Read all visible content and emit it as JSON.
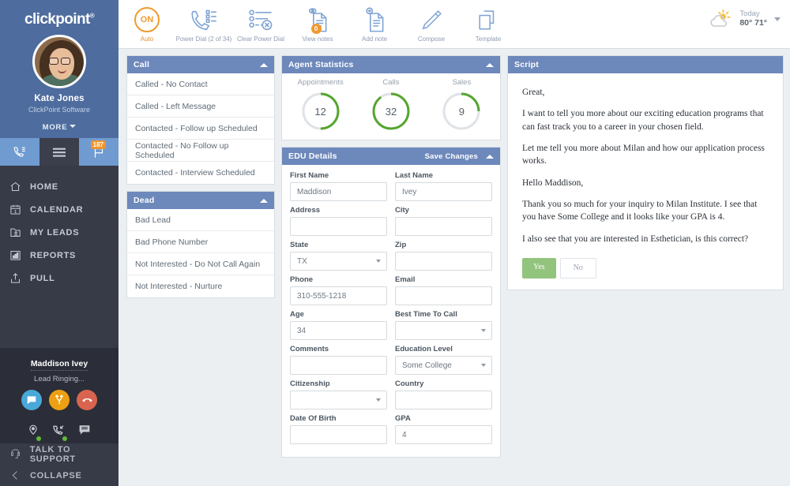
{
  "brand": {
    "logo": "clickpoint",
    "trademark": "®",
    "accent_blue": "#4e6c9e",
    "accent_orange": "#ef9a2e",
    "header_blue": "#6d88bb",
    "green": "#55a630"
  },
  "sidebar": {
    "user_name": "Kate Jones",
    "company": "ClickPoint Software",
    "more_label": "MORE",
    "flag_badge": "187",
    "nav": [
      {
        "label": "HOME",
        "icon": "home-icon"
      },
      {
        "label": "CALENDAR",
        "icon": "calendar-icon"
      },
      {
        "label": "MY LEADS",
        "icon": "leads-folder-icon"
      },
      {
        "label": "REPORTS",
        "icon": "bar-chart-icon"
      },
      {
        "label": "PULL",
        "icon": "upload-icon"
      }
    ],
    "call_card": {
      "lead_name": "Maddison Ivey",
      "status": "Lead Ringing...",
      "buttons": [
        {
          "name": "sms-button",
          "icon": "sms-icon"
        },
        {
          "name": "transfer-button",
          "icon": "transfer-icon"
        },
        {
          "name": "hangup-button",
          "icon": "hangup-icon"
        }
      ]
    },
    "bottom": [
      {
        "label": "TALK TO SUPPORT",
        "icon": "support-icon"
      },
      {
        "label": "COLLAPSE",
        "icon": "collapse-icon"
      }
    ]
  },
  "toolbar": {
    "items": [
      {
        "label": "Auto",
        "icon": "on-toggle-icon",
        "state": "ON"
      },
      {
        "label": "Power Dial (2 of 34)",
        "icon": "power-dial-icon"
      },
      {
        "label": "Clear Power Dial",
        "icon": "clear-power-dial-icon"
      },
      {
        "label": "View notes",
        "icon": "view-notes-icon",
        "badge": "0"
      },
      {
        "label": "Add note",
        "icon": "add-note-icon"
      },
      {
        "label": "Compose",
        "icon": "compose-pencil-icon"
      },
      {
        "label": "Template",
        "icon": "template-icon"
      }
    ],
    "weather": {
      "day": "Today",
      "temps": "80° 71°",
      "icon": "sun-cloud-icon"
    }
  },
  "call_panel": {
    "title": "Call",
    "items": [
      "Called - No Contact",
      "Called - Left Message",
      "Contacted - Follow up Scheduled",
      "Contacted - No Follow up Scheduled",
      "Contacted - Interview Scheduled"
    ]
  },
  "dead_panel": {
    "title": "Dead",
    "items": [
      "Bad Lead",
      "Bad Phone Number",
      "Not Interested - Do Not Call Again",
      "Not Interested - Nurture"
    ]
  },
  "agent_stats": {
    "title": "Agent Statistics",
    "gauges": [
      {
        "label": "Appointments",
        "value": "12",
        "percent": 50
      },
      {
        "label": "Calls",
        "value": "32",
        "percent": 90
      },
      {
        "label": "Sales",
        "value": "9",
        "percent": 25
      }
    ]
  },
  "edu_details": {
    "title": "EDU Details",
    "save_label": "Save Changes",
    "rows": [
      [
        {
          "label": "First Name",
          "value": "Maddison",
          "type": "text"
        },
        {
          "label": "Last Name",
          "value": "Ivey",
          "type": "text"
        }
      ],
      [
        {
          "label": "Address",
          "value": "",
          "type": "text"
        },
        {
          "label": "City",
          "value": "",
          "type": "text"
        }
      ],
      [
        {
          "label": "State",
          "value": "TX",
          "type": "select"
        },
        {
          "label": "Zip",
          "value": "",
          "type": "text"
        }
      ],
      [
        {
          "label": "Phone",
          "value": "310-555-1218",
          "type": "text"
        },
        {
          "label": "Email",
          "value": "",
          "type": "text"
        }
      ],
      [
        {
          "label": "Age",
          "value": "34",
          "type": "text"
        },
        {
          "label": "Best Time To Call",
          "value": "",
          "type": "select"
        }
      ],
      [
        {
          "label": "Comments",
          "value": "",
          "type": "text"
        },
        {
          "label": "Education Level",
          "value": "Some College",
          "type": "select"
        }
      ],
      [
        {
          "label": "Citizenship",
          "value": "",
          "type": "select"
        },
        {
          "label": "Country",
          "value": "",
          "type": "text"
        }
      ],
      [
        {
          "label": "Date Of Birth",
          "value": "",
          "type": "text"
        },
        {
          "label": "GPA",
          "value": "4",
          "type": "text"
        }
      ]
    ]
  },
  "script": {
    "title": "Script",
    "paragraphs": [
      "Great,",
      "I want to tell you more about our exciting education programs that can fast track you to a career in your chosen field.",
      "Let me tell you more about Milan and how our application process works.",
      "Hello Maddison,",
      "Thank you so much for your inquiry to Milan Institute.  I see that you have Some College and it looks like your GPA is 4.",
      "I also see that you are interested in Esthetician, is this correct?"
    ],
    "yes_label": "Yes",
    "no_label": "No"
  }
}
